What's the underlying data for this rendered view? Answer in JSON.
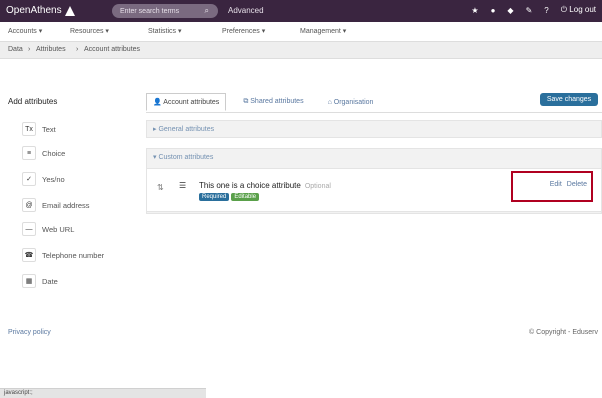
{
  "app": {
    "brand": "OpenAthens"
  },
  "search": {
    "placeholder": "Enter search terms"
  },
  "header": {
    "advanced": "Advanced",
    "logout": "Log out"
  },
  "menu": [
    "Accounts",
    "Resources",
    "Statistics",
    "Preferences",
    "Management"
  ],
  "breadcrumb": [
    "Data",
    "Attributes",
    "Account attributes"
  ],
  "sidebar": {
    "title": "Add attributes",
    "items": [
      {
        "label": "Text",
        "icon": "Tx"
      },
      {
        "label": "Choice",
        "icon": "≡"
      },
      {
        "label": "Yes/no",
        "icon": "✓"
      },
      {
        "label": "Email address",
        "icon": "@"
      },
      {
        "label": "Web URL",
        "icon": "—"
      },
      {
        "label": "Telephone number",
        "icon": "☎"
      },
      {
        "label": "Date",
        "icon": "▦"
      }
    ]
  },
  "tabs": [
    {
      "label": "Account attributes",
      "active": true
    },
    {
      "label": "Shared attributes",
      "active": false
    },
    {
      "label": "Organisation",
      "active": false
    }
  ],
  "save_label": "Save changes",
  "sections": {
    "general": "General attributes",
    "custom": "Custom attributes"
  },
  "attribute": {
    "name": "This one is a choice attribute",
    "muted": "Optional",
    "badges": [
      {
        "text": "Required",
        "color": "#2a6f9c"
      },
      {
        "text": "Editable",
        "color": "#5aa04a"
      }
    ],
    "actions": [
      "Edit",
      "Delete"
    ]
  },
  "footer": {
    "left": "Privacy policy",
    "right": "© Copyright - Eduserv"
  },
  "status": {
    "text": "javascript:;"
  }
}
